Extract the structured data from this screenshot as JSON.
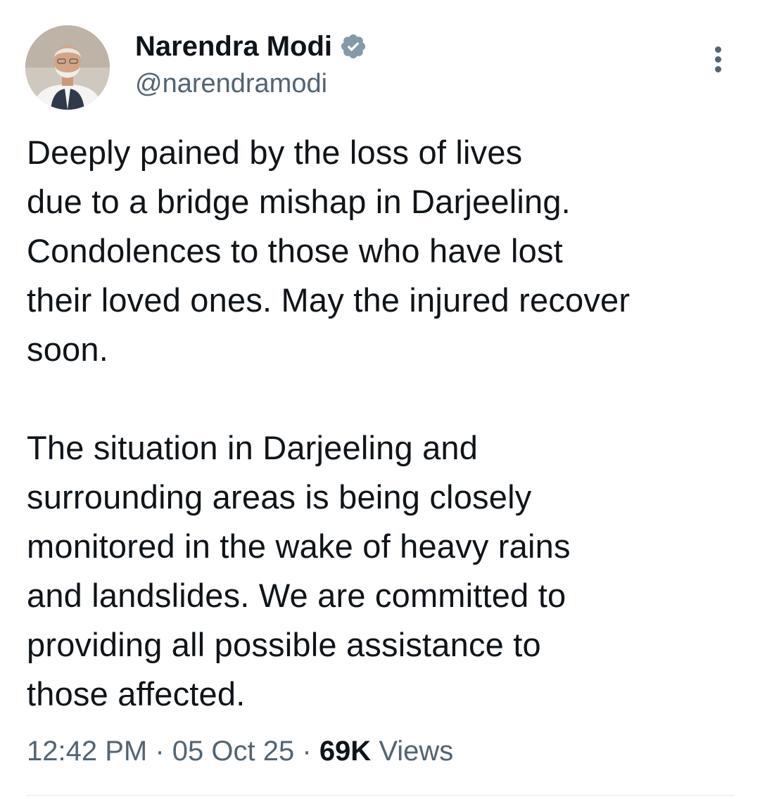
{
  "author": {
    "display_name": "Narendra Modi",
    "handle": "@narendramodi",
    "verified_icon": "verified-badge-icon",
    "avatar_icon": "profile-photo"
  },
  "more_icon": "ellipsis-vertical-icon",
  "tweet": {
    "paragraph_1": "Deeply pained by the loss of lives\ndue to a bridge mishap in Darjeeling.\nCondolences to those who have lost\ntheir loved ones. May the injured recover\nsoon.",
    "paragraph_2": "The situation in Darjeeling and\nsurrounding areas is being closely\nmonitored in the wake of heavy rains\nand landslides. We are committed to\nproviding all possible assistance to\nthose affected."
  },
  "meta": {
    "time": "12:42 PM",
    "separator": "·",
    "date": "05 Oct 25",
    "views_count": "69K",
    "views_label": "Views"
  },
  "colors": {
    "text_primary": "#0f1419",
    "text_secondary": "#536471",
    "verified": "#829aab",
    "divider": "#eff3f4"
  }
}
